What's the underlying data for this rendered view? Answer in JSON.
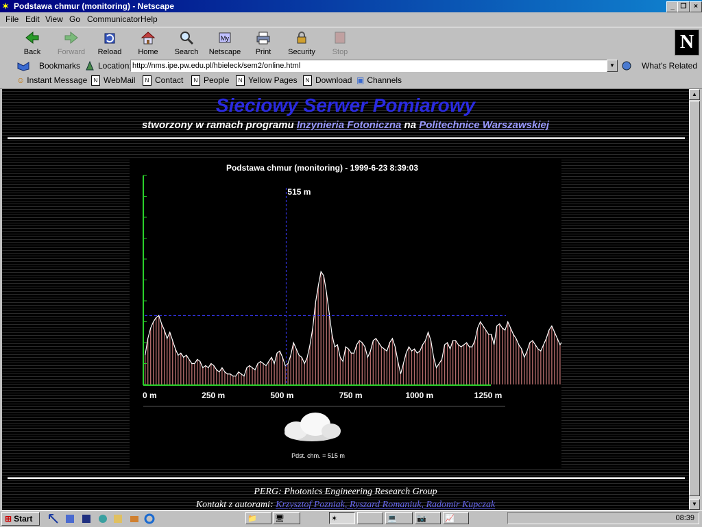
{
  "window": {
    "title": "Podstawa chmur (monitoring) - Netscape"
  },
  "menu": [
    "File",
    "Edit",
    "View",
    "Go",
    "Communicator",
    "Help"
  ],
  "toolbar": {
    "back": "Back",
    "forward": "Forward",
    "reload": "Reload",
    "home": "Home",
    "search": "Search",
    "netscape": "Netscape",
    "print": "Print",
    "security": "Security",
    "stop": "Stop"
  },
  "location": {
    "bookmarks": "Bookmarks",
    "label": "Location:",
    "url": "http://nms.ipe.pw.edu.pl/hbieleck/sem2/online.html",
    "related": "What's Related"
  },
  "personal": [
    "Instant Message",
    "WebMail",
    "Contact",
    "People",
    "Yellow Pages",
    "Download",
    "Channels"
  ],
  "page": {
    "heading": "Sieciowy Serwer Pomiarowy",
    "subtitle_pre": "stworzony w ramach programu",
    "subtitle_link1": "Inzynieria Fotoniczna",
    "subtitle_mid": "na",
    "subtitle_link2": "Politechnice Warszawskiej",
    "cloud_caption": "Pdst. chm. = 515 m",
    "footer_group": "PERG: Photonics Engineering Research Group",
    "footer_contact": "Kontakt z autorami:",
    "footer_authors": "Krzysztof Pozniak, Ryszard Romaniuk, Radomir Kupczak"
  },
  "chart_data": {
    "type": "bar",
    "title": "Podstawa chmur (monitoring) - 1999-6-23 8:39:03",
    "xlabel": "",
    "ylabel": "",
    "xlim": [
      0,
      1250
    ],
    "xticks": [
      "0 m",
      "250 m",
      "500 m",
      "750 m",
      "1000 m",
      "1250 m"
    ],
    "xtick_values": [
      0,
      250,
      500,
      750,
      1000,
      1250
    ],
    "ylim": [
      0,
      100
    ],
    "marker": {
      "x": 515,
      "label": "515 m"
    },
    "threshold": 33,
    "x_step": 10,
    "values": [
      14,
      22,
      27,
      30,
      32,
      33,
      29,
      26,
      22,
      25,
      21,
      17,
      14,
      15,
      13,
      14,
      12,
      10,
      10,
      12,
      11,
      8,
      9,
      8,
      10,
      9,
      7,
      6,
      8,
      6,
      5,
      5,
      4,
      4,
      6,
      5,
      4,
      8,
      9,
      8,
      7,
      10,
      11,
      10,
      9,
      11,
      13,
      10,
      15,
      16,
      13,
      9,
      10,
      14,
      20,
      17,
      14,
      13,
      10,
      13,
      19,
      27,
      39,
      47,
      54,
      52,
      44,
      34,
      24,
      18,
      19,
      13,
      11,
      18,
      17,
      15,
      15,
      19,
      21,
      20,
      18,
      13,
      16,
      21,
      22,
      20,
      18,
      17,
      16,
      20,
      22,
      18,
      11,
      5,
      10,
      15,
      18,
      16,
      17,
      15,
      16,
      19,
      21,
      25,
      21,
      13,
      8,
      10,
      12,
      19,
      20,
      17,
      21,
      21,
      19,
      18,
      19,
      20,
      18,
      18,
      21,
      27,
      30,
      28,
      26,
      24,
      24,
      19,
      28,
      29,
      27,
      26,
      30,
      27,
      24,
      22,
      19,
      17,
      13,
      16,
      20,
      21,
      19,
      17,
      16,
      19,
      22,
      26,
      28,
      25,
      22,
      19,
      21,
      23,
      21,
      18,
      16,
      15,
      14,
      12,
      17,
      16,
      17,
      20,
      25,
      31,
      30,
      26,
      19,
      23,
      28,
      27,
      27,
      27,
      19,
      20,
      26,
      28,
      25,
      27,
      27,
      26,
      22,
      22,
      21,
      18,
      24,
      21,
      22,
      27,
      26,
      28,
      27,
      29,
      28,
      22,
      17
    ]
  }
}
